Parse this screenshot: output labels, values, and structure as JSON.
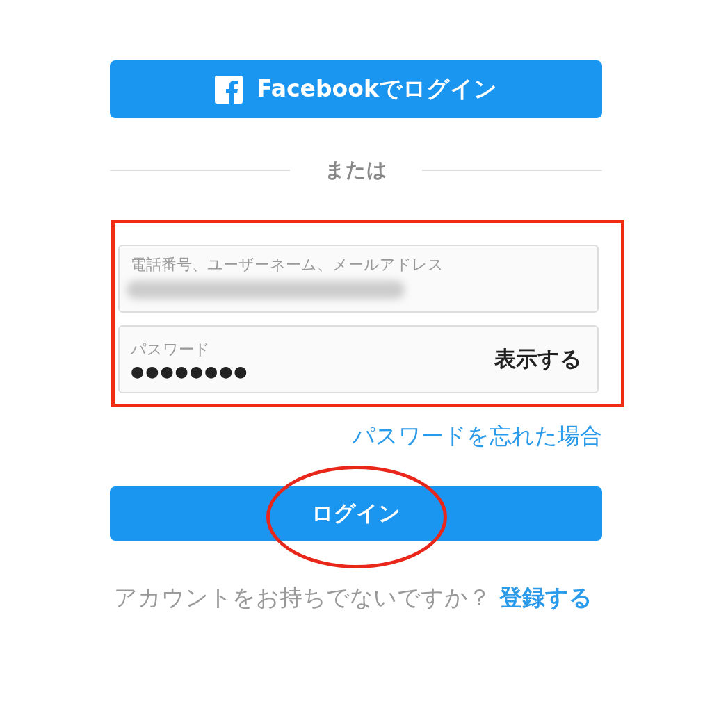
{
  "facebook_button": {
    "label": "Facebookでログイン"
  },
  "divider": {
    "label": "または"
  },
  "credentials": {
    "highlighted": true,
    "username": {
      "placeholder": "電話番号、ユーザーネーム、メールアドレス",
      "obscured": true
    },
    "password": {
      "placeholder": "パスワード",
      "value": "●●●●●●●●",
      "toggle": "表示する"
    }
  },
  "forgot_link": "パスワードを忘れた場合",
  "login_button": {
    "label": "ログイン",
    "circled": true
  },
  "signup": {
    "prompt": "アカウントをお持ちでないですか？",
    "link": "登録する"
  }
}
